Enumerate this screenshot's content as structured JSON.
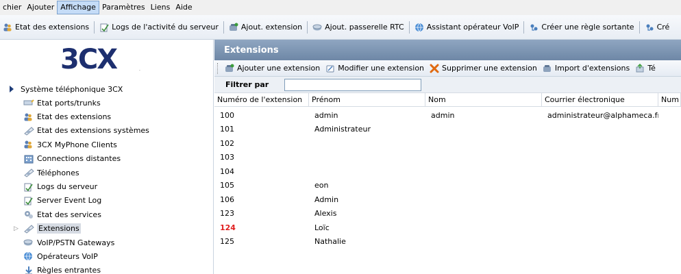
{
  "menu": [
    {
      "label": "chier",
      "active": false
    },
    {
      "label": "Ajouter",
      "active": false
    },
    {
      "label": "Affichage",
      "active": true
    },
    {
      "label": "Paramètres",
      "active": false
    },
    {
      "label": "Liens",
      "active": false
    },
    {
      "label": "Aide",
      "active": false
    }
  ],
  "toolbar": [
    {
      "label": "Etat des extensions",
      "icon": "users-icon"
    },
    {
      "label": "Logs de l'activité du serveur",
      "icon": "log-icon"
    },
    {
      "label": "Ajout. extension",
      "icon": "add-phone-icon"
    },
    {
      "label": "Ajout. passerelle RTC",
      "icon": "gateway-icon"
    },
    {
      "label": "Assistant opérateur VoIP",
      "icon": "globe-icon"
    },
    {
      "label": "Créer une règle sortante",
      "icon": "rule-icon"
    },
    {
      "label": "Cré",
      "icon": "rule-icon"
    }
  ],
  "logo": {
    "text": "3CX",
    "mark": "."
  },
  "tree": {
    "root": "Système téléphonique 3CX",
    "items": [
      {
        "label": "Etat ports/trunks",
        "icon": "ports-icon",
        "selected": false
      },
      {
        "label": "Etat des extensions",
        "icon": "users-icon",
        "selected": false
      },
      {
        "label": "Etat des extensions systèmes",
        "icon": "phone-icon",
        "selected": false
      },
      {
        "label": "3CX MyPhone Clients",
        "icon": "users-icon",
        "selected": false
      },
      {
        "label": "Connections distantes",
        "icon": "building-icon",
        "selected": false
      },
      {
        "label": "Téléphones",
        "icon": "phone-icon",
        "selected": false
      },
      {
        "label": "Logs du serveur",
        "icon": "log-icon",
        "selected": false
      },
      {
        "label": "Server Event Log",
        "icon": "log-icon",
        "selected": false
      },
      {
        "label": "Etat des services",
        "icon": "services-icon",
        "selected": false
      },
      {
        "label": "Extensions",
        "icon": "phone-icon",
        "selected": true
      },
      {
        "label": "VoIP/PSTN Gateways",
        "icon": "gateway-icon",
        "selected": false
      },
      {
        "label": "Opérateurs VoIP",
        "icon": "globe-icon",
        "selected": false
      },
      {
        "label": "Règles entrantes",
        "icon": "inbound-icon",
        "selected": false
      }
    ]
  },
  "panel": {
    "title": "Extensions",
    "actions": [
      {
        "label": "Ajouter une extension",
        "icon": "add-phone-icon"
      },
      {
        "label": "Modifier une extension",
        "icon": "edit-icon"
      },
      {
        "label": "Supprimer une extension",
        "icon": "delete-icon"
      },
      {
        "label": "Import d'extensions",
        "icon": "import-icon"
      },
      {
        "label": "Té",
        "icon": "export-icon"
      }
    ],
    "filter_label": "Filtrer par",
    "filter_value": "",
    "columns": [
      "Numéro de l'extension",
      "Prénom",
      "Nom",
      "Courrier électronique",
      "Num"
    ],
    "rows": [
      {
        "num": "100",
        "prenom": "admin",
        "nom": "admin",
        "email": "administrateur@alphameca.fr",
        "highlight": false
      },
      {
        "num": "101",
        "prenom": "Administrateur",
        "nom": "",
        "email": "",
        "highlight": false
      },
      {
        "num": "102",
        "prenom": "",
        "nom": "",
        "email": "",
        "highlight": false
      },
      {
        "num": "103",
        "prenom": "",
        "nom": "",
        "email": "",
        "highlight": false
      },
      {
        "num": "104",
        "prenom": "",
        "nom": "",
        "email": "",
        "highlight": false
      },
      {
        "num": "105",
        "prenom": "eon",
        "nom": "",
        "email": "",
        "highlight": false
      },
      {
        "num": "106",
        "prenom": "Admin",
        "nom": "",
        "email": "",
        "highlight": false
      },
      {
        "num": "123",
        "prenom": "Alexis",
        "nom": "",
        "email": "",
        "highlight": false
      },
      {
        "num": "124",
        "prenom": "Loïc",
        "nom": "",
        "email": "",
        "highlight": true
      },
      {
        "num": "125",
        "prenom": "Nathalie",
        "nom": "",
        "email": "",
        "highlight": false
      }
    ]
  },
  "colors": {
    "accent": "#1d2f6f",
    "highlight_text": "#e02020",
    "header_bg": "#7b92b0"
  }
}
